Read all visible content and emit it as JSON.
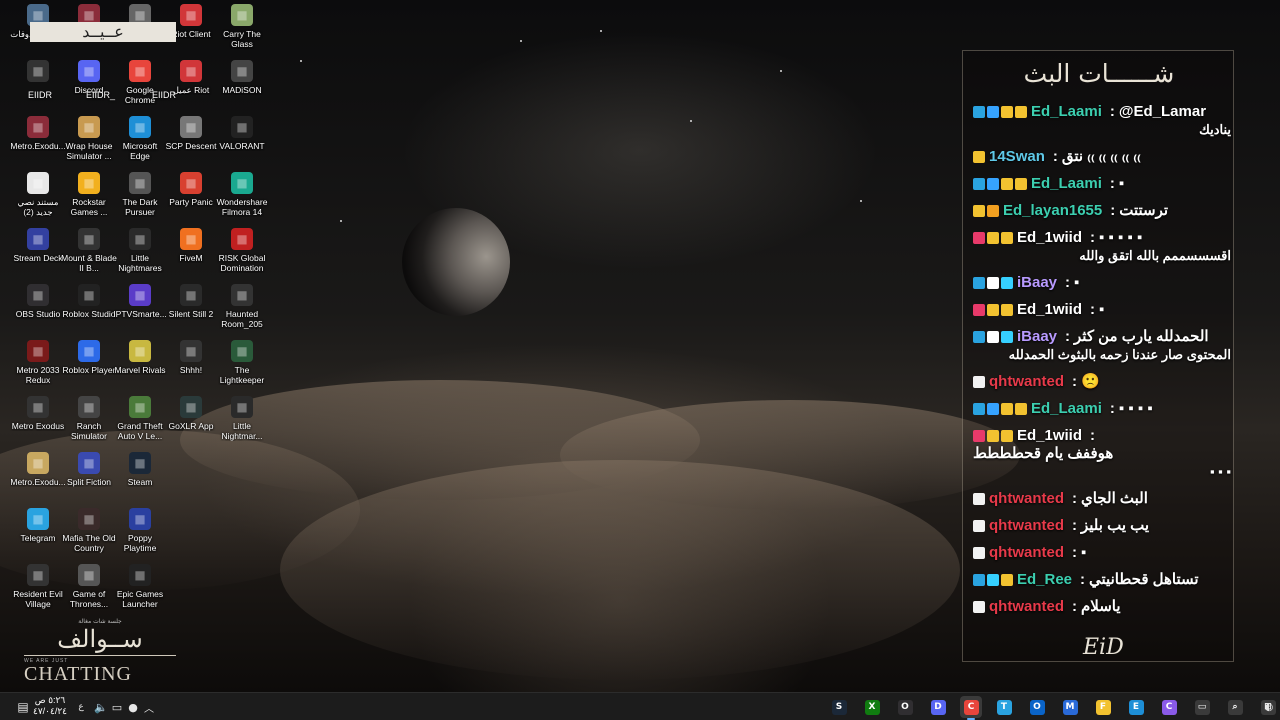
{
  "desktop": {
    "icons": [
      {
        "label": "سلة المحذوفات",
        "icon": "recycle-bin-icon",
        "color": "#4a6a8a"
      },
      {
        "label": "",
        "icon": "winrar-icon",
        "color": "#8b2c3a"
      },
      {
        "label": "",
        "icon": "cursor-app-icon",
        "color": "#666666"
      },
      {
        "label": "Riot Client",
        "icon": "riot-icon",
        "color": "#d13639"
      },
      {
        "label": "Carry The Glass",
        "icon": "carry-glass-icon",
        "color": "#8aa86a"
      },
      {
        "label": "",
        "icon": "eiidr-icon",
        "color": "#333333"
      },
      {
        "label": "Discord",
        "icon": "discord-icon",
        "color": "#5865f2"
      },
      {
        "label": "Google Chrome",
        "icon": "chrome-icon",
        "color": "#e8453c"
      },
      {
        "label": "عميل Riot",
        "icon": "riot-icon",
        "color": "#d13639"
      },
      {
        "label": "MADiSON",
        "icon": "madison-icon",
        "color": "#444444"
      },
      {
        "label": "Metro.Exodu...",
        "icon": "winrar-icon",
        "color": "#8b2c3a"
      },
      {
        "label": "Wrap House Simulator ...",
        "icon": "game-icon",
        "color": "#c89a50"
      },
      {
        "label": "Microsoft Edge",
        "icon": "edge-icon",
        "color": "#1e8fd6"
      },
      {
        "label": "SCP Descent",
        "icon": "scp-icon",
        "color": "#777777"
      },
      {
        "label": "VALORANT",
        "icon": "valorant-icon",
        "color": "#222222"
      },
      {
        "label": "مستند نصي جديد (2)",
        "icon": "text-file-icon",
        "color": "#e8e8e8"
      },
      {
        "label": "Rockstar Games ...",
        "icon": "rockstar-icon",
        "color": "#f2b01e"
      },
      {
        "label": "The Dark Pursuer",
        "icon": "game-icon",
        "color": "#555555"
      },
      {
        "label": "Party Panic",
        "icon": "game-icon",
        "color": "#d84030"
      },
      {
        "label": "Wondershare Filmora 14",
        "icon": "filmora-icon",
        "color": "#1aa990"
      },
      {
        "label": "Stream Deck",
        "icon": "stream-deck-icon",
        "color": "#3340a0"
      },
      {
        "label": "Mount & Blade II B...",
        "icon": "game-icon",
        "color": "#333333"
      },
      {
        "label": "Little Nightmares",
        "icon": "game-icon",
        "color": "#2a2a2a"
      },
      {
        "label": "FiveM",
        "icon": "fivem-icon",
        "color": "#f07020"
      },
      {
        "label": "RISK Global Domination",
        "icon": "risk-icon",
        "color": "#c02020"
      },
      {
        "label": "OBS Studio",
        "icon": "obs-icon",
        "color": "#302e31"
      },
      {
        "label": "Roblox Studio",
        "icon": "roblox-icon",
        "color": "#222222"
      },
      {
        "label": "IPTVSmarte...",
        "icon": "iptv-icon",
        "color": "#5a3cc8"
      },
      {
        "label": "Silent Still 2",
        "icon": "game-icon",
        "color": "#2a2a2a"
      },
      {
        "label": "Haunted Room_205",
        "icon": "game-icon",
        "color": "#333333"
      },
      {
        "label": "Metro 2033 Redux",
        "icon": "game-icon",
        "color": "#7a1a1a"
      },
      {
        "label": "Roblox Player",
        "icon": "roblox-icon",
        "color": "#2d6ae8"
      },
      {
        "label": "Marvel Rivals",
        "icon": "game-icon",
        "color": "#c8b840"
      },
      {
        "label": "Shhh!",
        "icon": "game-icon",
        "color": "#333333"
      },
      {
        "label": "The Lightkeeper",
        "icon": "game-icon",
        "color": "#2a5a3a"
      },
      {
        "label": "Metro Exodus",
        "icon": "game-icon",
        "color": "#333333"
      },
      {
        "label": "Ranch Simulator",
        "icon": "game-icon",
        "color": "#444444"
      },
      {
        "label": "Grand Theft Auto V Le...",
        "icon": "gta-icon",
        "color": "#4a7a3a"
      },
      {
        "label": "GoXLR App",
        "icon": "goxlr-icon",
        "color": "#2a3a3a"
      },
      {
        "label": "Little Nightmar...",
        "icon": "game-icon",
        "color": "#2a2a2a"
      },
      {
        "label": "Metro.Exodu...",
        "icon": "file-icon",
        "color": "#c8a860"
      },
      {
        "label": "Split Fiction",
        "icon": "game-icon",
        "color": "#3a4ab0"
      },
      {
        "label": "Steam",
        "icon": "steam-icon",
        "color": "#1b2838"
      },
      {
        "label": "",
        "icon": "",
        "color": ""
      },
      {
        "label": "",
        "icon": "",
        "color": ""
      },
      {
        "label": "Telegram",
        "icon": "telegram-icon",
        "color": "#2aa3e0"
      },
      {
        "label": "Mafia The Old Country",
        "icon": "game-icon",
        "color": "#3a2a2a"
      },
      {
        "label": "Poppy Playtime",
        "icon": "game-icon",
        "color": "#2a40a0"
      },
      {
        "label": "",
        "icon": "",
        "color": ""
      },
      {
        "label": "",
        "icon": "",
        "color": ""
      },
      {
        "label": "Resident Evil Village",
        "icon": "game-icon",
        "color": "#333333"
      },
      {
        "label": "Game of Thrones...",
        "icon": "game-icon",
        "color": "#555555"
      },
      {
        "label": "Epic Games Launcher",
        "icon": "epic-icon",
        "color": "#222222"
      }
    ]
  },
  "overlay": {
    "eiidr_1": "EIIDR",
    "eiidr_2": "EIIDR_",
    "eiidr_3": "EIIDR",
    "top_left_ar": "عــيــد"
  },
  "brand": {
    "small": "جلسة شات مغالة",
    "title": "ســوالف",
    "tiny": "WE ARE JUST",
    "big": "CHATTING"
  },
  "chat": {
    "title": "شــــــات البث",
    "logo": "EiD",
    "messages": [
      {
        "badges": [
          "#2aa3e0",
          "#36a3ff",
          "#f2c230",
          "#f2c230"
        ],
        "user": "Ed_Laami",
        "user_color": "#3ccfb0",
        "text": "@Ed_Lamar",
        "text2": "يناديك"
      },
      {
        "badges": [
          "#f2c230"
        ],
        "user": "14Swan",
        "user_color": "#5fc9e8",
        "text": "نتق ₍₍ ₍₍ ₍₍ ₍₍ ₍₍"
      },
      {
        "badges": [
          "#2aa3e0",
          "#36a3ff",
          "#f2c230",
          "#f2c230"
        ],
        "user": "Ed_Laami",
        "user_color": "#3ccfb0",
        "text": "▪"
      },
      {
        "badges": [
          "#f2c230",
          "#f2a020"
        ],
        "user": "Ed_layan1655",
        "user_color": "#3ccfb0",
        "text": "ترستتت"
      },
      {
        "badges": [
          "#e83a6a",
          "#f2c230",
          "#f2c230"
        ],
        "user": "Ed_1wiid",
        "user_color": "#ffffff",
        "text": "▪ ▪ ▪ ▪ ▪",
        "text2": "اقسسسممم بالله اتقق والله"
      },
      {
        "badges": [
          "#2aa3e0",
          "#ffffff",
          "#36d0ff"
        ],
        "user": "iBaay",
        "user_color": "#b89aff",
        "text": "▪"
      },
      {
        "badges": [
          "#e83a6a",
          "#f2c230",
          "#f2c230"
        ],
        "user": "Ed_1wiid",
        "user_color": "#ffffff",
        "text": "▪"
      },
      {
        "badges": [
          "#2aa3e0",
          "#ffffff",
          "#36d0ff"
        ],
        "user": "iBaay",
        "user_color": "#b89aff",
        "text": "الحمدلله يارب من كثر",
        "text2": "المحتوى صار عندنا زحمه بالبثوث الحمدلله"
      },
      {
        "badges": [
          "#f2f2f2"
        ],
        "user": "qhtwanted",
        "user_color": "#e83a4a",
        "text": "🙁"
      },
      {
        "badges": [
          "#2aa3e0",
          "#36a3ff",
          "#f2c230",
          "#f2c230"
        ],
        "user": "Ed_Laami",
        "user_color": "#3ccfb0",
        "text": "▪ ▪ ▪ ▪"
      },
      {
        "badges": [
          "#e83a6a",
          "#f2c230",
          "#f2c230"
        ],
        "user": "Ed_1wiid",
        "user_color": "#ffffff",
        "text": "هوففف يام قحطططط",
        "text2": "▪ ▪ ▪"
      },
      {
        "badges": [
          "#f2f2f2"
        ],
        "user": "qhtwanted",
        "user_color": "#e83a4a",
        "text": "البث الجاي"
      },
      {
        "badges": [
          "#f2f2f2"
        ],
        "user": "qhtwanted",
        "user_color": "#e83a4a",
        "text": "يب يب بليز"
      },
      {
        "badges": [
          "#f2f2f2"
        ],
        "user": "qhtwanted",
        "user_color": "#e83a4a",
        "text": "▪"
      },
      {
        "badges": [
          "#2aa3e0",
          "#36d0ff",
          "#f2c230"
        ],
        "user": "Ed_Ree",
        "user_color": "#3ccfb0",
        "text": "تستاهل قحطانيتي"
      },
      {
        "badges": [
          "#f2f2f2"
        ],
        "user": "qhtwanted",
        "user_color": "#e83a4a",
        "text": "ياسلام"
      }
    ]
  },
  "taskbar": {
    "clock_time": "٥:٢٦ ص",
    "clock_date": "٤٧/٠٤/٢٤",
    "lang": "ع",
    "apps": [
      {
        "name": "steam-icon",
        "color": "#1b2838",
        "glyph": "S"
      },
      {
        "name": "xbox-icon",
        "color": "#107c10",
        "glyph": "X"
      },
      {
        "name": "obs-icon",
        "color": "#302e31",
        "glyph": "O"
      },
      {
        "name": "discord-icon",
        "color": "#5865f2",
        "glyph": "D"
      },
      {
        "name": "chrome-icon",
        "color": "#e8453c",
        "glyph": "C"
      },
      {
        "name": "telegram-icon",
        "color": "#2aa3e0",
        "glyph": "T"
      },
      {
        "name": "outlook-icon",
        "color": "#0a64c8",
        "glyph": "O"
      },
      {
        "name": "store-icon",
        "color": "#2a6ad8",
        "glyph": "M"
      },
      {
        "name": "file-explorer-icon",
        "color": "#f2c230",
        "glyph": "F"
      },
      {
        "name": "edge-icon",
        "color": "#1e8fd6",
        "glyph": "E"
      },
      {
        "name": "copilot-icon",
        "color": "#8a5ae8",
        "glyph": "C"
      },
      {
        "name": "task-view-icon",
        "color": "#3a3a3a",
        "glyph": "▭"
      },
      {
        "name": "search-icon",
        "color": "#3a3a3a",
        "glyph": "⌕"
      },
      {
        "name": "start-icon",
        "color": "#3a3a3a",
        "glyph": "⊞"
      }
    ]
  }
}
